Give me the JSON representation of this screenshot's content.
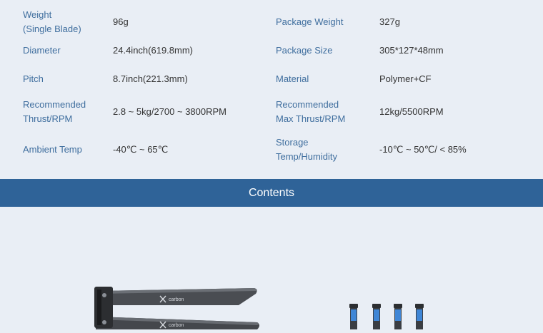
{
  "specs": {
    "weight_label_1": "Weight",
    "weight_label_2": "(Single Blade)",
    "weight_value": "96g",
    "package_weight_label": "Package Weight",
    "package_weight_value": "327g",
    "diameter_label": "Diameter",
    "diameter_value": "24.4inch(619.8mm)",
    "package_size_label": "Package Size",
    "package_size_value": "305*127*48mm",
    "pitch_label": "Pitch",
    "pitch_value": "8.7inch(221.3mm)",
    "material_label": "Material",
    "material_value": "Polymer+CF",
    "rec_thrust_label_1": "Recommended",
    "rec_thrust_label_2": "Thrust/RPM",
    "rec_thrust_value": "2.8 ~ 5kg/2700 ~ 3800RPM",
    "rec_max_label_1": "Recommended",
    "rec_max_label_2": "Max Thrust/RPM",
    "rec_max_value": "12kg/5500RPM",
    "ambient_label": "Ambient Temp",
    "ambient_value": "-40℃ ~ 65℃",
    "storage_label_1": "Storage",
    "storage_label_2": "Temp/Humidity",
    "storage_value": "-10℃ ~ 50℃/ < 85%"
  },
  "contents": {
    "heading": "Contents",
    "propeller_logo_text": "carbon"
  },
  "colors": {
    "label": "#3f6e9e",
    "value": "#333333",
    "banner": "#2f6398",
    "background": "#e9eef5"
  }
}
